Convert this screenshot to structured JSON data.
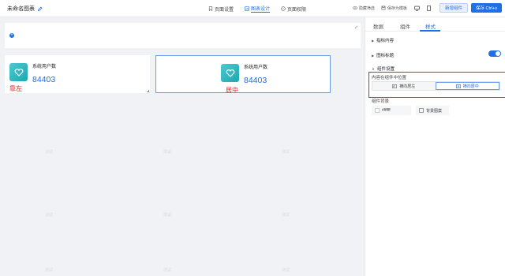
{
  "header": {
    "title": "未命名图表",
    "nav": [
      {
        "label": "页面设置",
        "icon": "bookmark-icon"
      },
      {
        "label": "图表设计",
        "icon": "chart-design-icon",
        "active": true
      },
      {
        "label": "页面权限",
        "icon": "lock-icon"
      }
    ],
    "tools": {
      "hide_filter": "隐藏筛选",
      "save_template": "保存为模板"
    },
    "new_widget_label": "新增组件",
    "save_label": "保存 Ctrl+s"
  },
  "canvas": {
    "widgets": [
      {
        "title": "系统用户数",
        "value": "84403"
      },
      {
        "title": "系统用户数",
        "value": "84403"
      }
    ],
    "annotations": {
      "left": "靠左",
      "center": "居中"
    },
    "watermark": "测试"
  },
  "panel": {
    "tabs": [
      "数据",
      "组件",
      "样式"
    ],
    "active_tab": "样式",
    "sections": {
      "indicator_content": "指标内容",
      "chart_title": "图标标题",
      "widget_settings": "组件设置"
    },
    "position_label": "内容在组件中位置",
    "position_options": [
      "横向居左",
      "横向居中"
    ],
    "position_selected": "横向居中",
    "background_label": "组件背景",
    "background_color": "#ffffff",
    "background_image_label": "背景图案",
    "accent_color": "#1f6fe5",
    "annotation_color": "#e02020"
  }
}
